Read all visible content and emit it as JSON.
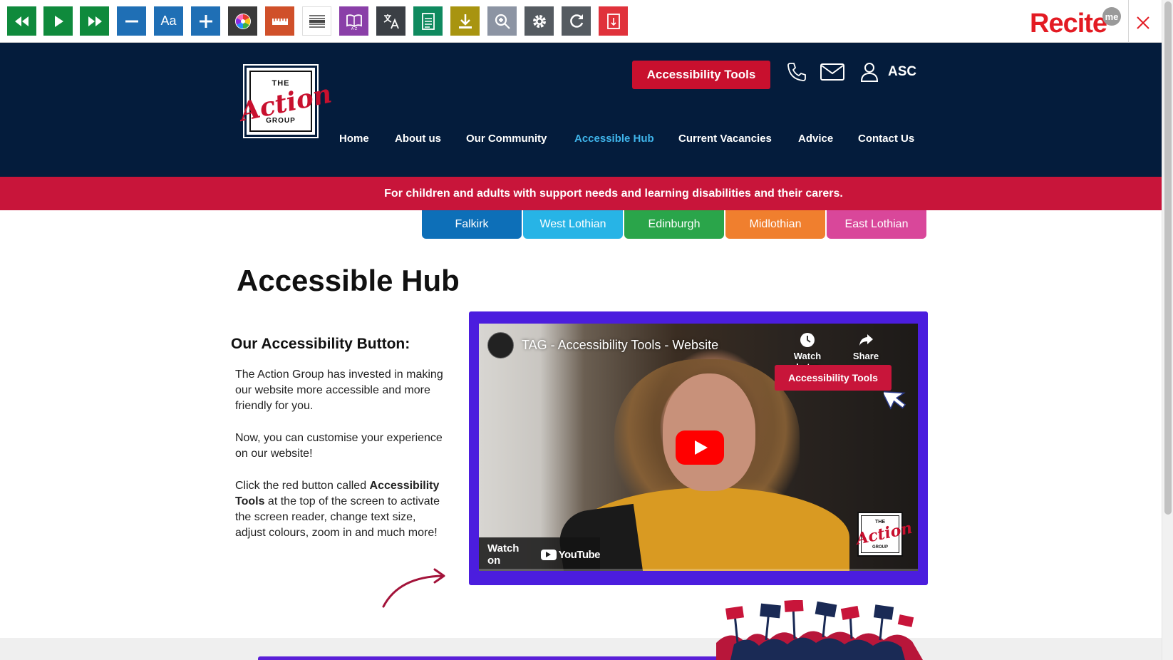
{
  "recite": {
    "logo_text": "Recite",
    "me_badge": "me",
    "buttons": [
      {
        "name": "rewind-icon",
        "color": "#0f8a3c"
      },
      {
        "name": "play-icon",
        "color": "#0f8a3c"
      },
      {
        "name": "fast-forward-icon",
        "color": "#0f8a3c"
      },
      {
        "name": "decrease-text-icon",
        "color": "#1f6fb5"
      },
      {
        "name": "font-icon",
        "color": "#1f6fb5",
        "text": "Aa"
      },
      {
        "name": "increase-text-icon",
        "color": "#1f6fb5"
      },
      {
        "name": "color-wheel-icon",
        "color": "#3a3a3a"
      },
      {
        "name": "ruler-icon",
        "color": "#d0502a"
      },
      {
        "name": "text-mask-icon",
        "color": "#555555"
      },
      {
        "name": "dictionary-icon",
        "color": "#8a3fa8"
      },
      {
        "name": "translate-icon",
        "color": "#3b3f45"
      },
      {
        "name": "text-only-icon",
        "color": "#0f8a5f"
      },
      {
        "name": "download-icon",
        "color": "#a89410"
      },
      {
        "name": "magnifier-icon",
        "color": "#8c94a3"
      },
      {
        "name": "settings-gear-icon",
        "color": "#555b61"
      },
      {
        "name": "reset-icon",
        "color": "#555b61"
      },
      {
        "name": "pdf-icon",
        "color": "#e0323b"
      }
    ]
  },
  "header": {
    "logo": {
      "the": "THE",
      "action": "Action",
      "group": "GROUP"
    },
    "accessibility_button": "Accessibility Tools",
    "account_label": "ASC",
    "nav": [
      {
        "label": "Home",
        "active": false
      },
      {
        "label": "About us",
        "active": false
      },
      {
        "label": "Our Community",
        "active": false
      },
      {
        "label": "Accessible Hub",
        "active": true
      },
      {
        "label": "Current Vacancies",
        "active": false
      },
      {
        "label": "Advice",
        "active": false
      },
      {
        "label": "Contact Us",
        "active": false
      }
    ]
  },
  "banner": "For children and adults with support needs and learning disabilities and their carers.",
  "regions": [
    {
      "label": "Falkirk",
      "color": "#0d6fb8"
    },
    {
      "label": "West Lothian",
      "color": "#27b4e6"
    },
    {
      "label": "Edinburgh",
      "color": "#2aa54a"
    },
    {
      "label": "Midlothian",
      "color": "#f07f2e"
    },
    {
      "label": "East Lothian",
      "color": "#d9479a"
    }
  ],
  "main": {
    "title": "Accessible Hub",
    "subtitle": "Our Accessibility Button:",
    "para1": "The Action Group has invested in making our website more accessible and more friendly for you.",
    "para2": "Now, you can customise your experience on our website!",
    "para3_before": "Click the red button called ",
    "para3_bold": "Accessibility Tools",
    "para3_after": " at the top of the screen to activate the screen reader, change text size, adjust colours, zoom in and much more!"
  },
  "video": {
    "title": "TAG - Accessibility Tools - Website",
    "watch_later": "Watch Later",
    "share": "Share",
    "overlay_button": "Accessibility Tools",
    "watch_on": "Watch on",
    "youtube": "YouTube",
    "logo": {
      "the": "THE",
      "action": "Action",
      "group": "GROUP"
    }
  }
}
